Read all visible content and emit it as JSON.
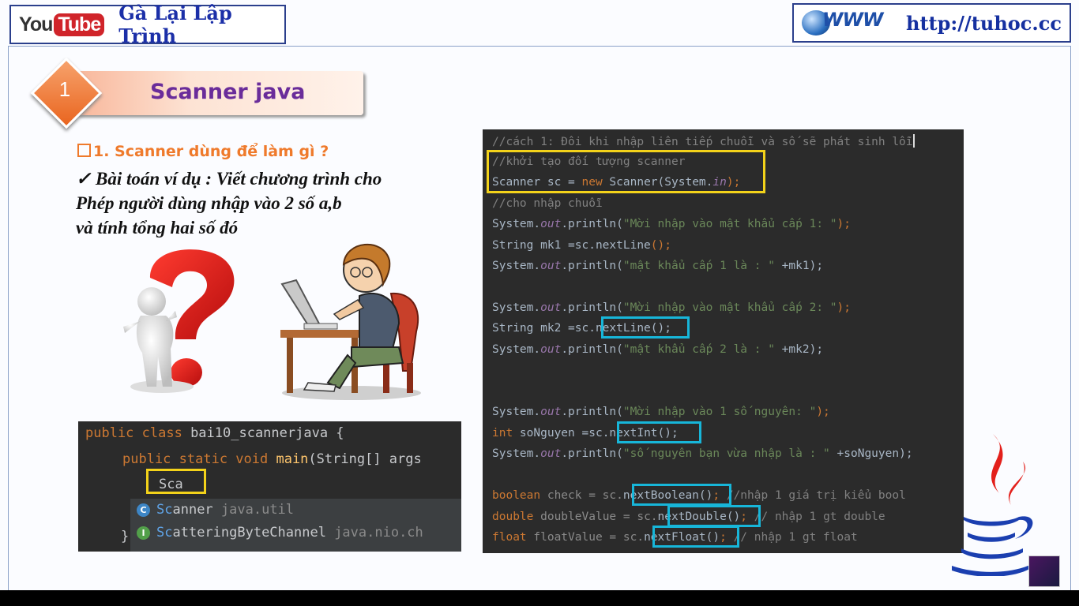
{
  "header": {
    "youtube_you": "You",
    "youtube_tube": "Tube",
    "channel_name": "Gà Lại Lập Trình",
    "www_logo": "WWW",
    "site_url": "http://tuhoc.cc"
  },
  "section": {
    "number": "1",
    "title": "Scanner java"
  },
  "content": {
    "question": "1. Scanner dùng để làm gì  ?",
    "para_line1": "✓ Bài toán ví dụ : Viết chương trình cho",
    "para_line2": "Phép người dùng nhập vào 2 số a,b",
    "para_line3": "và tính tổng hai số đó"
  },
  "small_code": {
    "line1_kw": "public class ",
    "line1_rest": "bai10_scannerjava {",
    "line2_kw": "public static void ",
    "line2_fn": "main",
    "line2_rest": "(String[] args",
    "typed": "Sca",
    "brace": "}",
    "suggestions": [
      {
        "icon": "C",
        "name_hl": "Sc",
        "name": "anner",
        "pkg": " java.util"
      },
      {
        "icon": "I",
        "name_hl": "Sc",
        "name": "atteringByteChannel",
        "pkg": " java.nio.ch"
      }
    ]
  },
  "big_code": {
    "l1": "//cách 1: Đôi khi nhập liên tiếp chuỗi và số sẽ phát sinh lỗi",
    "l2": "//khởi tạo đối tượng scanner",
    "l3a": "Scanner sc = ",
    "l3b": "new",
    "l3c": " Scanner(System.",
    "l3d": "in",
    "l3e": ");",
    "l4": "//cho nhập chuỗi",
    "sys": "System.",
    "out": "out",
    "println": ".println(",
    "l5s": "\"Mời nhập vào mật khẩu cấp 1: \"",
    "end": ");",
    "l6a": "String mk1 =sc.nextLine",
    "l6b": "();",
    "l7s": "\"mật khẩu cấp 1 là : \"",
    "l7b": " +mk1);",
    "l8s": "\"Mời nhập vào mật khẩu cấp 2: \"",
    "l9a": "String mk2 =sc.",
    "l9b": "nextLine();",
    "l10s": "\"mật khẩu cấp 2 là : \"",
    "l10b": " +mk2);",
    "l11s": "\"Mời nhập vào 1 số nguyên: \"",
    "l12k": "int",
    "l12a": " soNguyen =sc.",
    "l12b": "nextInt();",
    "l13s": "\"số nguyên bạn vừa nhập là : \"",
    "l13b": " +soNguyen);",
    "l14k": "boolean",
    "l14a": " check = sc.",
    "l14b": "nextBoolean()",
    "l14c": "; ",
    "l14d": "//nhập 1 giá trị kiểu bool",
    "l15k": "double",
    "l15a": " doubleValue = sc.",
    "l15b": "nextDouble()",
    "l15c": "; ",
    "l15d": "// nhập 1 gt double",
    "l16k": "float",
    "l16a": " floatValue = sc.",
    "l16b": "nextFloat()",
    "l16c": "; ",
    "l16d": "// nhập 1 gt float"
  },
  "colors": {
    "yellow_highlight": "#f3d21a",
    "cyan_highlight": "#17b6d9",
    "accent_orange": "#ef7a2b",
    "title_purple": "#6a2c9a"
  }
}
